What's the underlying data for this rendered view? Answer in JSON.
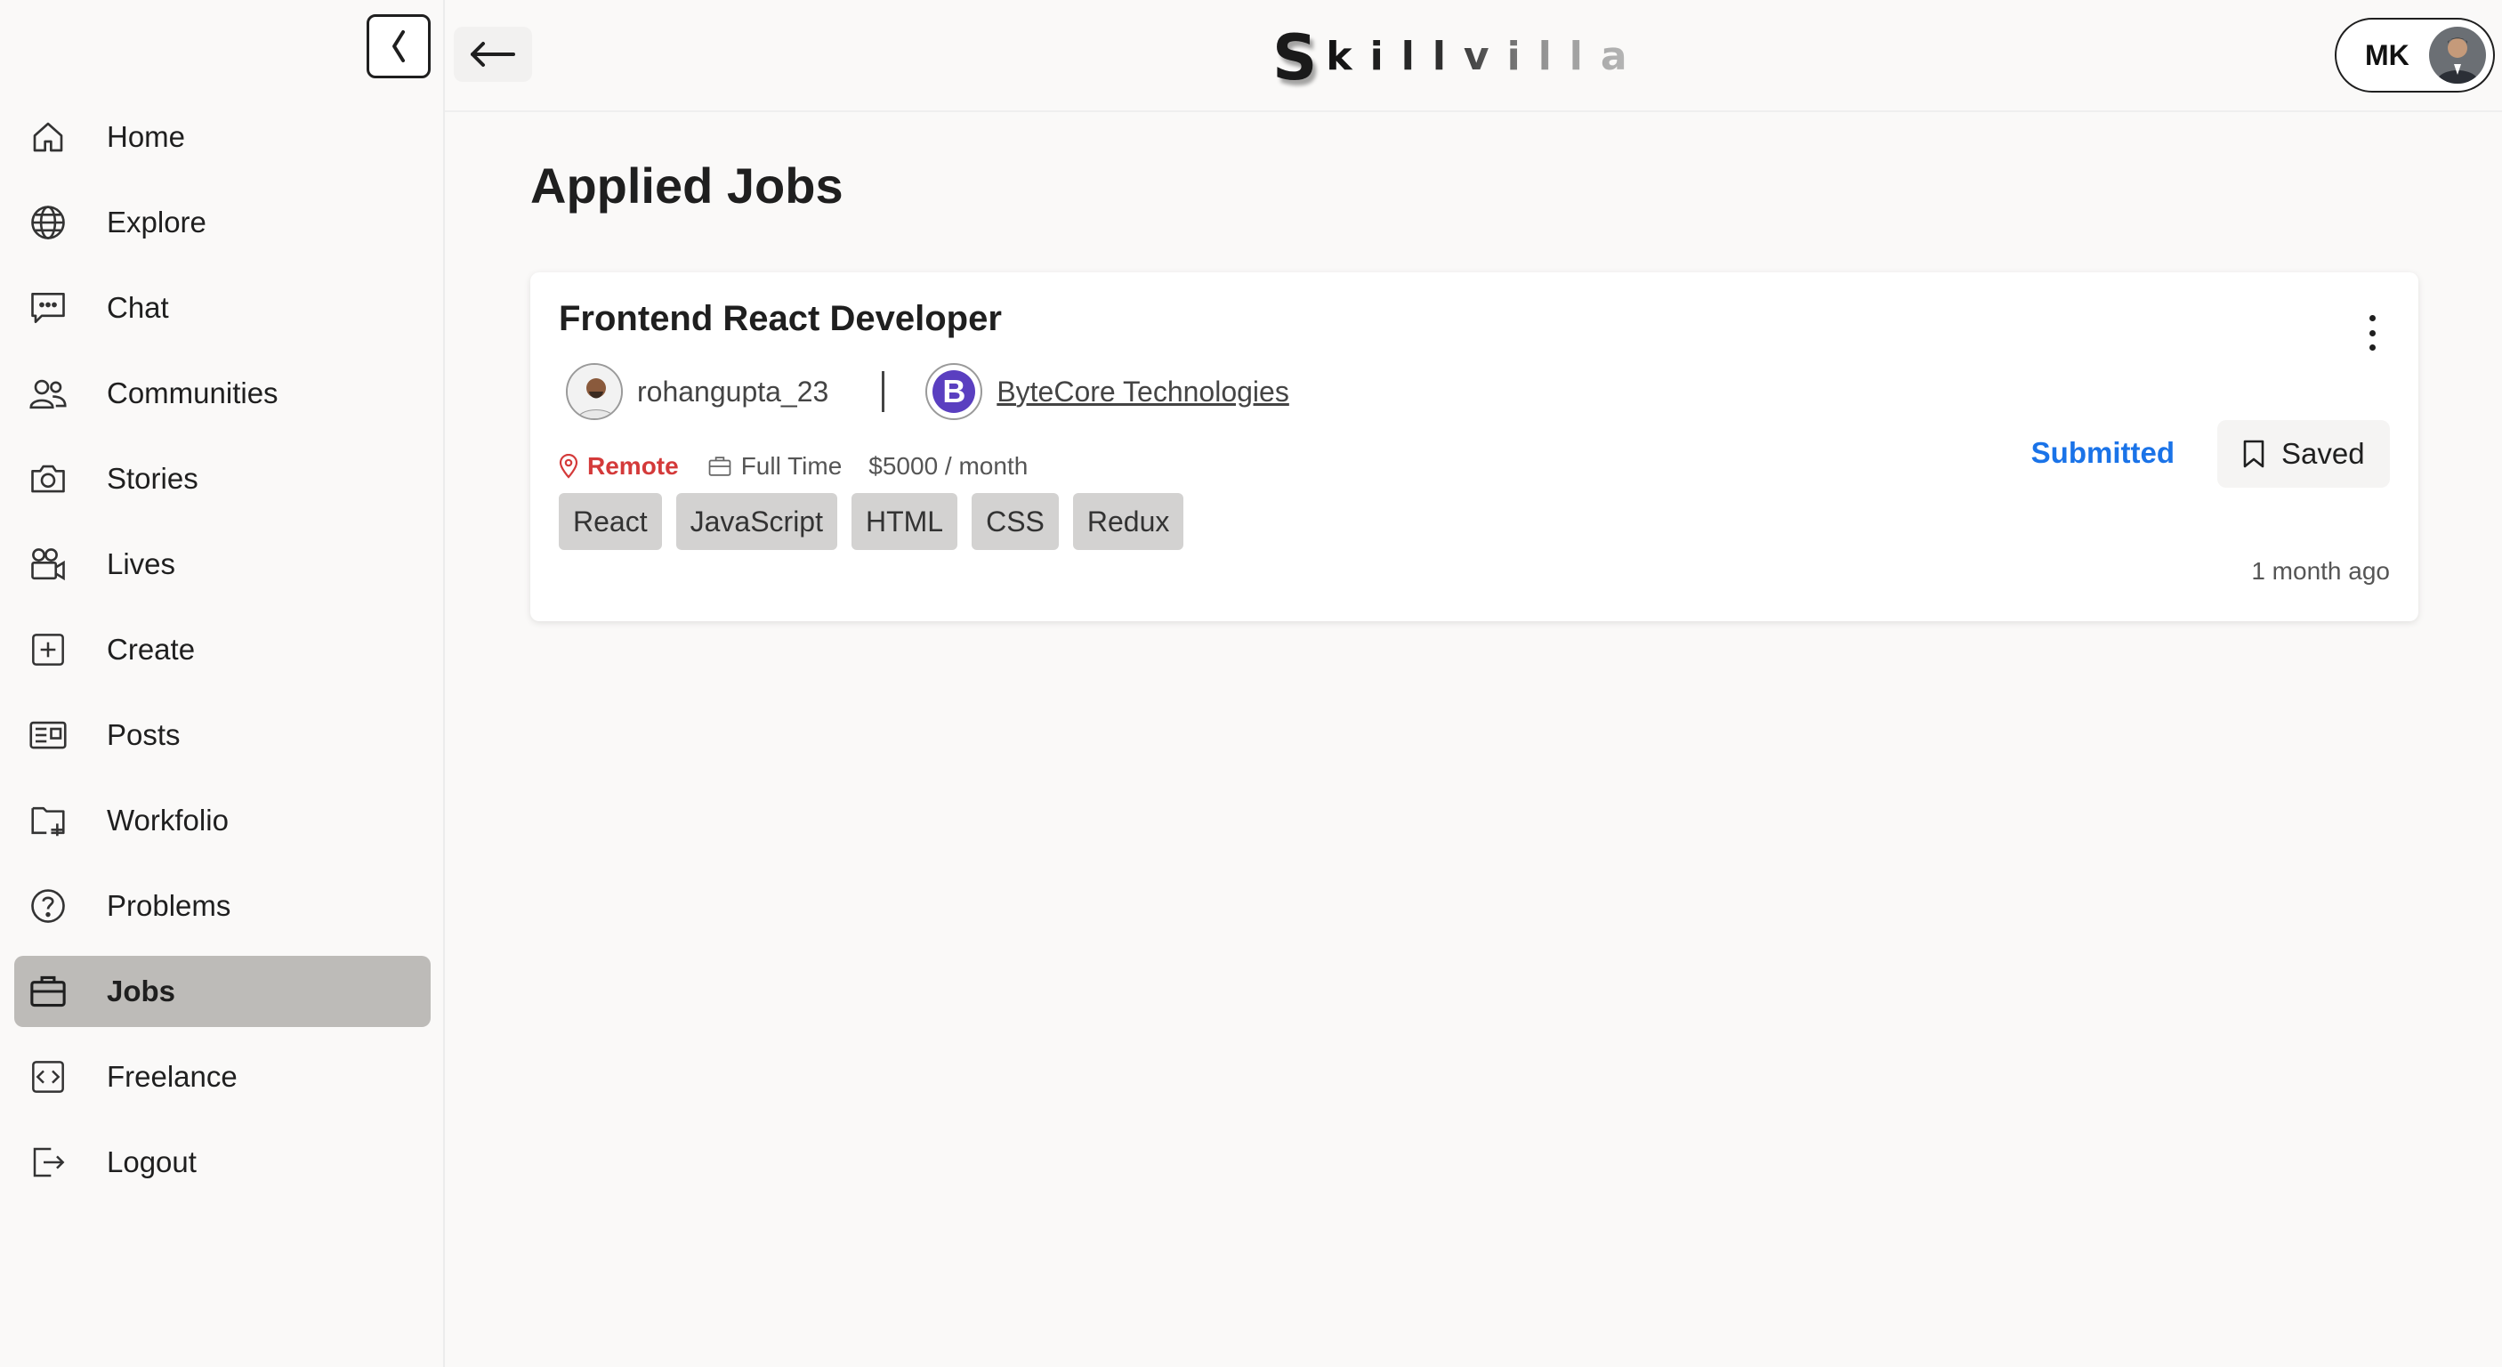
{
  "sidebar": {
    "items": [
      {
        "label": "Home",
        "icon": "home-icon"
      },
      {
        "label": "Explore",
        "icon": "globe-icon"
      },
      {
        "label": "Chat",
        "icon": "chat-icon"
      },
      {
        "label": "Communities",
        "icon": "users-icon"
      },
      {
        "label": "Stories",
        "icon": "camera-icon"
      },
      {
        "label": "Lives",
        "icon": "video-camera-icon"
      },
      {
        "label": "Create",
        "icon": "plus-square-icon"
      },
      {
        "label": "Posts",
        "icon": "newspaper-icon"
      },
      {
        "label": "Workfolio",
        "icon": "folder-plus-icon"
      },
      {
        "label": "Problems",
        "icon": "question-circle-icon"
      },
      {
        "label": "Jobs",
        "icon": "briefcase-icon",
        "active": true
      },
      {
        "label": "Freelance",
        "icon": "code-square-icon"
      },
      {
        "label": "Logout",
        "icon": "logout-icon"
      }
    ]
  },
  "header": {
    "logo_first": "S",
    "logo_rest": "killvilla",
    "profile_initials": "MK"
  },
  "main": {
    "title": "Applied Jobs",
    "job": {
      "title": "Frontend React Developer",
      "poster_username": "rohangupta_23",
      "company_letter": "B",
      "company_name": "ByteCore Technologies",
      "location": "Remote",
      "job_type": "Full Time",
      "salary": "$5000 / month",
      "tags": [
        "React",
        "JavaScript",
        "HTML",
        "CSS",
        "Redux"
      ],
      "status": "Submitted",
      "saved_label": "Saved",
      "posted_ago": "1 month ago"
    }
  },
  "colors": {
    "accent_blue": "#1a73e8",
    "location_red": "#d43a3a",
    "active_nav_bg": "#bdbbb8",
    "company_logo_bg": "#5a3fc0"
  }
}
